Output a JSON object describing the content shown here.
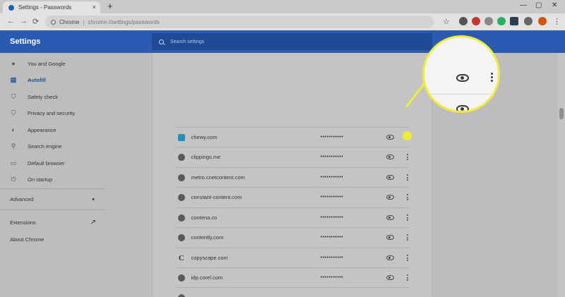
{
  "browser": {
    "tab_title": "Settings - Passwords",
    "tab_close": "×",
    "new_tab": "+",
    "window_controls": [
      "—",
      "▢",
      "✕"
    ],
    "url_host": "Chrome",
    "url_path": "chrome://settings/passwords",
    "nav": [
      "←",
      "→",
      "⟳"
    ]
  },
  "header": {
    "title": "Settings",
    "search_placeholder": "Search settings"
  },
  "sidebar": {
    "items": [
      {
        "label": "You and Google",
        "icon": "person-icon",
        "glyph": "●"
      },
      {
        "label": "Autofill",
        "icon": "clipboard-icon",
        "glyph": "▤",
        "active": true
      },
      {
        "label": "Safety check",
        "icon": "shield-icon",
        "glyph": "⛉"
      },
      {
        "label": "Privacy and security",
        "icon": "privacy-shield-icon",
        "glyph": "⛉"
      },
      {
        "label": "Appearance",
        "icon": "palette-icon",
        "glyph": "◐"
      },
      {
        "label": "Search engine",
        "icon": "search-icon",
        "glyph": "⚲"
      },
      {
        "label": "Default browser",
        "icon": "browser-icon",
        "glyph": "▭"
      },
      {
        "label": "On startup",
        "icon": "power-icon",
        "glyph": "⏻"
      }
    ],
    "advanced": "Advanced",
    "advanced_chevron": "▾",
    "extensions": "Extensions",
    "extensions_icon": "↗",
    "about": "About Chrome"
  },
  "passwords": {
    "rows": [
      {
        "site": "chewy.com",
        "icon": "chewy",
        "password": "•••••••••••"
      },
      {
        "site": "clippings.me",
        "icon": "globe",
        "password": "•••••••••••"
      },
      {
        "site": "metro.cnetcontent.com",
        "icon": "globe",
        "password": "•••••••••••"
      },
      {
        "site": "constant-content.com",
        "icon": "globe",
        "password": "•••••••••••"
      },
      {
        "site": "contena.co",
        "icon": "globe",
        "password": "•••••••••••"
      },
      {
        "site": "contently.com",
        "icon": "globe",
        "password": "•••••••••••"
      },
      {
        "site": "copyscape.com",
        "icon": "copy",
        "password": "•••••••••••",
        "icon_glyph": "C"
      },
      {
        "site": "idp.corel.com",
        "icon": "globe",
        "password": "•••••••••••"
      },
      {
        "site": "",
        "icon": "globe",
        "password": ""
      }
    ]
  },
  "colors": {
    "header": "#2a5bb0",
    "highlight": "#f1ec3c",
    "active_nav": "#1a4fa0"
  }
}
